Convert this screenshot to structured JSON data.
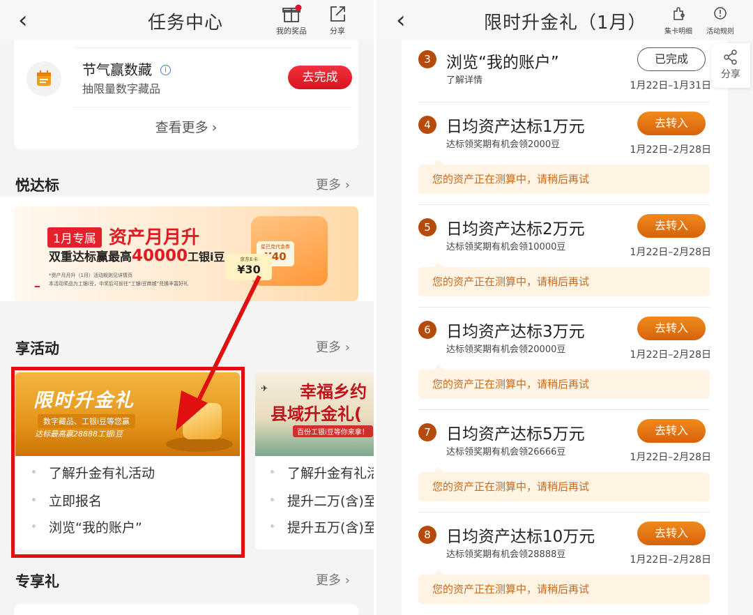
{
  "left": {
    "header": {
      "back_glyph": "‹",
      "title": "任务中心",
      "prize_label": "我的奖品",
      "share_label": "分享"
    },
    "task_card": {
      "title": "节气赢数藏",
      "info_glyph": "i",
      "subtitle": "抽限量数字藏品",
      "button": "去完成",
      "more_link": "查看更多"
    },
    "section_yue": {
      "title": "悦达标",
      "more": "更多"
    },
    "banner1": {
      "tag": "1月专属",
      "headline": "资产月月升",
      "line2_prefix": "双重达标赢最高",
      "line2_number": "40000",
      "line2_suffix": "工银i豆",
      "fine1": "*资产月月升（1月）活动规则见详情页",
      "fine2": "本活动奖品为工银i豆，中奖后可前往“工银i豆商城”兑换丰富好礼",
      "coupon1_top": "京东E卡",
      "coupon1_value": "¥30",
      "coupon2_top": "星巴克代金券",
      "coupon2_value": "¥40"
    },
    "section_xiang": {
      "title": "享活动",
      "more": "更多"
    },
    "activity1": {
      "banner_title": "限时升金礼",
      "banner_sub": "数字藏品、工银i豆等您赢",
      "banner_sub2": "达标最高赢28888工银i豆",
      "items": [
        "了解升金有礼活动",
        "立即报名",
        "浏览“我的账户”"
      ]
    },
    "activity2": {
      "banner_title1": "幸福乡约",
      "banner_title2": "县域升金礼(",
      "banner_sub": "百份工银i豆等你来拿！",
      "items": [
        "了解升金有礼活",
        "提升二万(含)至",
        "提升五万(含)至"
      ]
    },
    "section_zhuan": {
      "title": "专享礼",
      "more": "更多"
    }
  },
  "right": {
    "header": {
      "back_glyph": "‹",
      "title": "限时升金礼（1月）",
      "card_detail_label": "集卡明细",
      "rules_label": "活动规则"
    },
    "share_float": "分享",
    "tasks": [
      {
        "num": "3",
        "title": "浏览“我的账户”",
        "sub": "了解详情",
        "button": "已完成",
        "done": true,
        "date": "1月22日–1月31日"
      },
      {
        "num": "4",
        "title": "日均资产达标1万元",
        "sub": "达标领奖期有机会领2000豆",
        "button": "去转入",
        "date": "1月22日–2月28日",
        "notice": "您的资产正在测算中，请稍后再试"
      },
      {
        "num": "5",
        "title": "日均资产达标2万元",
        "sub": "达标领奖期有机会领10000豆",
        "button": "去转入",
        "date": "1月22日–2月28日",
        "notice": "您的资产正在测算中，请稍后再试"
      },
      {
        "num": "6",
        "title": "日均资产达标3万元",
        "sub": "达标领奖期有机会领20000豆",
        "button": "去转入",
        "date": "1月22日–2月28日",
        "notice": "您的资产正在测算中，请稍后再试"
      },
      {
        "num": "7",
        "title": "日均资产达标5万元",
        "sub": "达标领奖期有机会领26666豆",
        "button": "去转入",
        "date": "1月22日–2月28日",
        "notice": "您的资产正在测算中，请稍后再试"
      },
      {
        "num": "8",
        "title": "日均资产达标10万元",
        "sub": "达标领奖期有机会领28888豆",
        "button": "去转入",
        "date": "1月22日–2月28日",
        "notice": "您的资产正在测算中，请稍后再试"
      }
    ]
  },
  "colors": {
    "brand_red": "#e02030",
    "accent_orange": "#e06d10",
    "notice_bg": "#fff3e3",
    "annotation_red": "#e01010"
  },
  "icons": {
    "back": "chevron-left-icon",
    "gift": "gift-icon",
    "share": "share-icon",
    "calendar": "calendar-icon",
    "puzzle": "puzzle-icon",
    "info": "info-circle-icon"
  }
}
